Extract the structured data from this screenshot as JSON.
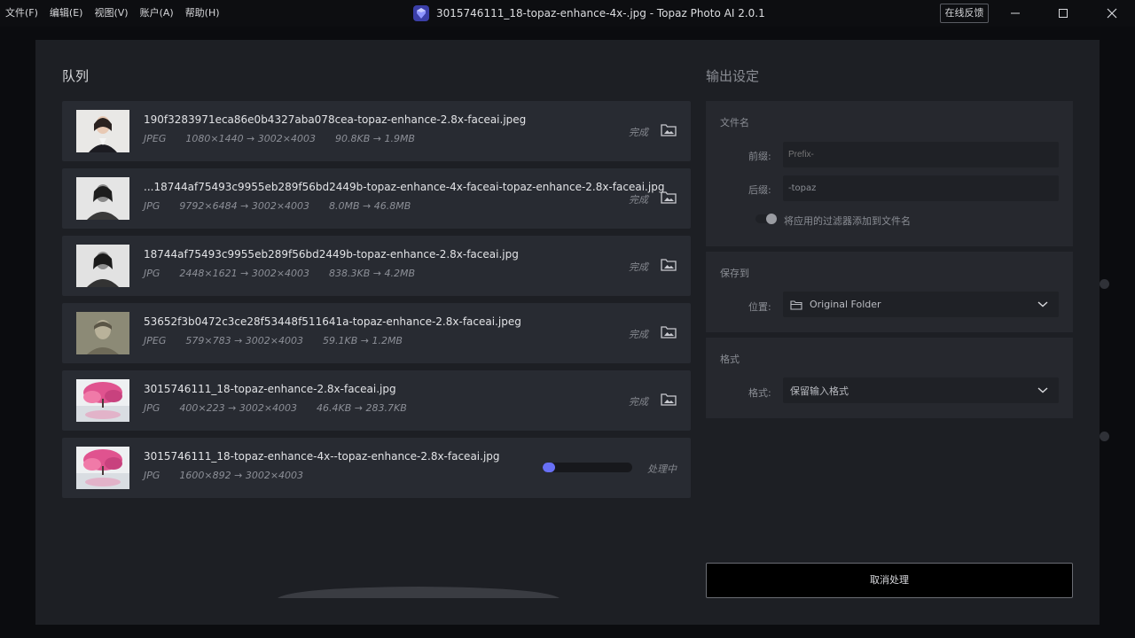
{
  "menu": [
    "文件(F)",
    "编辑(E)",
    "视图(V)",
    "账户(A)",
    "帮助(H)"
  ],
  "window": {
    "title": "3015746111_18-topaz-enhance-4x-.jpg - Topaz Photo AI 2.0.1",
    "feedback_label": "在线反馈"
  },
  "queue": {
    "title": "队列",
    "items": [
      {
        "filename": "190f3283971eca86e0b4327aba078cea-topaz-enhance-2.8x-faceai.jpeg",
        "format": "JPEG",
        "dims": "1080×1440 → 3002×4003",
        "size": "90.8KB → 1.9MB",
        "status": "完成"
      },
      {
        "filename": "...18744af75493c9955eb289f56bd2449b-topaz-enhance-4x-faceai-topaz-enhance-2.8x-faceai.jpg",
        "format": "JPG",
        "dims": "9792×6484 → 3002×4003",
        "size": "8.0MB → 46.8MB",
        "status": "完成"
      },
      {
        "filename": "18744af75493c9955eb289f56bd2449b-topaz-enhance-2.8x-faceai.jpg",
        "format": "JPG",
        "dims": "2448×1621 → 3002×4003",
        "size": "838.3KB → 4.2MB",
        "status": "完成"
      },
      {
        "filename": "53652f3b0472c3ce28f53448f511641a-topaz-enhance-2.8x-faceai.jpeg",
        "format": "JPEG",
        "dims": "579×783 → 3002×4003",
        "size": "59.1KB → 1.2MB",
        "status": "完成"
      },
      {
        "filename": "3015746111_18-topaz-enhance-2.8x-faceai.jpg",
        "format": "JPG",
        "dims": "400×223 → 3002×4003",
        "size": "46.4KB → 283.7KB",
        "status": "完成"
      },
      {
        "filename": "3015746111_18-topaz-enhance-4x--topaz-enhance-2.8x-faceai.jpg",
        "format": "JPG",
        "dims": "1600×892 → 3002×4003",
        "size": "",
        "status": "处理中",
        "progress": 0.14
      }
    ]
  },
  "output": {
    "title": "输出设定",
    "filename_section": "文件名",
    "prefix_label": "前缀:",
    "prefix_placeholder": "Prefix-",
    "suffix_label": "后缀:",
    "suffix_value": "-topaz",
    "toggle_label": "将应用的过滤器添加到文件名",
    "save_section": "保存到",
    "location_label": "位置:",
    "location_value": "Original Folder",
    "format_section": "格式",
    "format_label": "格式:",
    "format_value": "保留输入格式",
    "cancel_label": "取消处理"
  },
  "colors": {
    "accent": "#6870f5",
    "panel": "#26282e",
    "row": "#282b32",
    "dialog": "#1d1f24"
  }
}
